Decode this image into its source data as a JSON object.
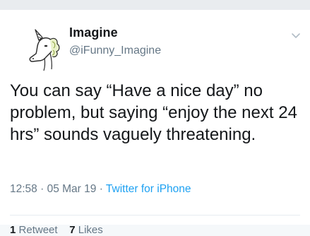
{
  "tweet": {
    "display_name": "Imagine",
    "handle": "@iFunny_Imagine",
    "text": "You can say “Have a nice day” no problem, but saying “enjoy the next 24 hrs” sounds vaguely threatening.",
    "time": "12:58",
    "date": "05 Mar 19",
    "separator": "·",
    "source": "Twitter for iPhone",
    "retweets_count": "1",
    "retweets_label": "Retweet",
    "likes_count": "7",
    "likes_label": "Likes"
  },
  "icons": {
    "avatar": "unicorn-avatar-icon",
    "menu": "chevron-down-icon"
  },
  "colors": {
    "link": "#1da1f2",
    "secondary_text": "#657786",
    "primary_text": "#14171a"
  }
}
